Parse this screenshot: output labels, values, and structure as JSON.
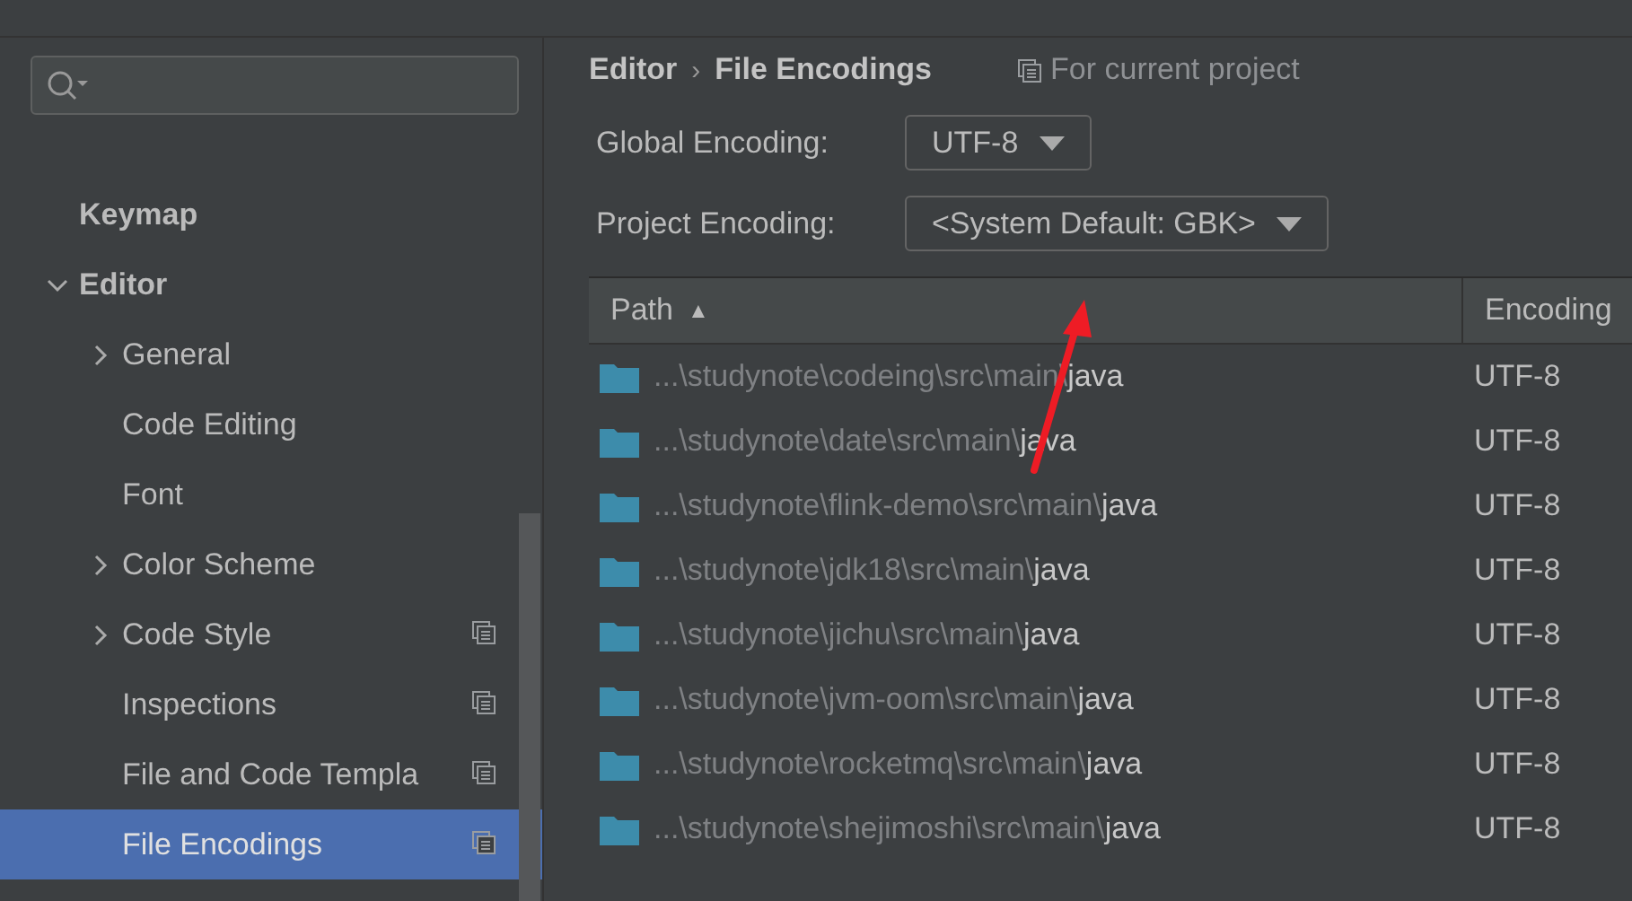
{
  "sidebar": {
    "items": [
      {
        "label": "Keymap",
        "selected": false,
        "project": false
      },
      {
        "label": "Editor",
        "selected": false,
        "project": false,
        "expanded": true,
        "children": [
          {
            "label": "General",
            "selected": false,
            "project": false,
            "expanded": false
          },
          {
            "label": "Code Editing",
            "selected": false,
            "project": false
          },
          {
            "label": "Font",
            "selected": false,
            "project": false
          },
          {
            "label": "Color Scheme",
            "selected": false,
            "project": false,
            "expanded": false
          },
          {
            "label": "Code Style",
            "selected": false,
            "project": true,
            "expanded": false
          },
          {
            "label": "Inspections",
            "selected": false,
            "project": true
          },
          {
            "label": "File and Code Templa",
            "selected": false,
            "project": true
          },
          {
            "label": "File Encodings",
            "selected": true,
            "project": true
          }
        ]
      }
    ]
  },
  "breadcrumb": {
    "items": [
      "Editor",
      "File Encodings"
    ],
    "separator": "›"
  },
  "scope_note": "For current project",
  "fields": [
    {
      "label": "Global Encoding:",
      "value": "UTF-8"
    },
    {
      "label": "Project Encoding:",
      "value": "<System Default: GBK>"
    }
  ],
  "table": {
    "columns": [
      {
        "label": "Path",
        "sort_indicator": "▲"
      },
      {
        "label": "Encoding"
      }
    ],
    "rows": [
      {
        "path": "...\\studynote\\codeing\\src\\main\\",
        "leaf": "java",
        "encoding": "UTF-8"
      },
      {
        "path": "...\\studynote\\date\\src\\main\\",
        "leaf": "java",
        "encoding": "UTF-8"
      },
      {
        "path": "...\\studynote\\flink-demo\\src\\main\\",
        "leaf": "java",
        "encoding": "UTF-8"
      },
      {
        "path": "...\\studynote\\jdk18\\src\\main\\",
        "leaf": "java",
        "encoding": "UTF-8"
      },
      {
        "path": "...\\studynote\\jichu\\src\\main\\",
        "leaf": "java",
        "encoding": "UTF-8"
      },
      {
        "path": "...\\studynote\\jvm-oom\\src\\main\\",
        "leaf": "java",
        "encoding": "UTF-8"
      },
      {
        "path": "...\\studynote\\rocketmq\\src\\main\\",
        "leaf": "java",
        "encoding": "UTF-8"
      },
      {
        "path": "...\\studynote\\shejimoshi\\src\\main\\",
        "leaf": "java",
        "encoding": "UTF-8"
      }
    ]
  }
}
